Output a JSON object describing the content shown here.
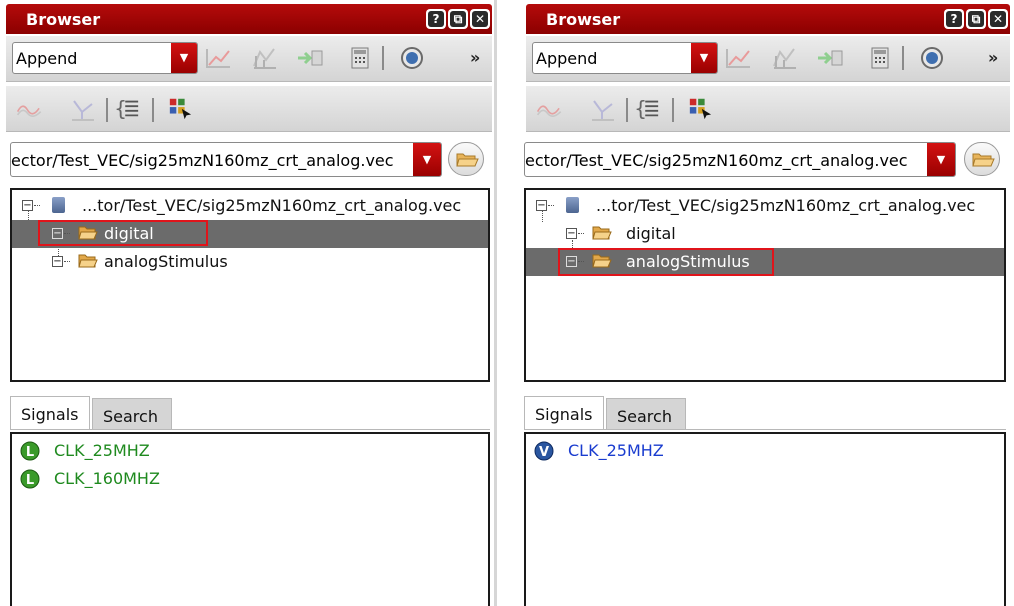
{
  "panels": [
    {
      "title": "Browser",
      "title_buttons": [
        "?",
        "⧉",
        "✕"
      ],
      "mode_select": {
        "value": "Append"
      },
      "overflow_label": "»",
      "path_select": {
        "value": "ector/Test_VEC/sig25mzN160mz_crt_analog.vec"
      },
      "tree": {
        "root": {
          "label": "...tor/Test_VEC/sig25mzN160mz_crt_analog.vec",
          "icon": "database-icon"
        },
        "children": [
          {
            "label": "digital",
            "icon": "folder-open-icon",
            "selected": true,
            "highlighted": true
          },
          {
            "label": "analogStimulus",
            "icon": "folder-open-icon",
            "selected": false,
            "highlighted": false
          }
        ]
      },
      "tabs": [
        {
          "label": "Signals",
          "active": true
        },
        {
          "label": "Search",
          "active": false
        }
      ],
      "signals": [
        {
          "label": "CLK_25MHZ",
          "icon": "logic-signal-icon",
          "color": "#1f8a1f"
        },
        {
          "label": "CLK_160MHZ",
          "icon": "logic-signal-icon",
          "color": "#1f8a1f"
        }
      ]
    },
    {
      "title": "Browser",
      "title_buttons": [
        "?",
        "⧉",
        "✕"
      ],
      "mode_select": {
        "value": "Append"
      },
      "overflow_label": "»",
      "path_select": {
        "value": "ector/Test_VEC/sig25mzN160mz_crt_analog.vec"
      },
      "tree": {
        "root": {
          "label": "...tor/Test_VEC/sig25mzN160mz_crt_analog.vec",
          "icon": "database-icon"
        },
        "children": [
          {
            "label": "digital",
            "icon": "folder-open-icon",
            "selected": false,
            "highlighted": false
          },
          {
            "label": "analogStimulus",
            "icon": "folder-open-icon",
            "selected": true,
            "highlighted": true
          }
        ]
      },
      "tabs": [
        {
          "label": "Signals",
          "active": true
        },
        {
          "label": "Search",
          "active": false
        }
      ],
      "signals": [
        {
          "label": "CLK_25MHZ",
          "icon": "vector-signal-icon",
          "color": "#1a3ccf"
        }
      ]
    }
  ],
  "colors": {
    "title_bar": "#a00000",
    "selection": "#6b6b6b",
    "highlight_box": "#e0141b",
    "logic_signal": "#1f8a1f",
    "vector_signal": "#1a3ccf"
  }
}
